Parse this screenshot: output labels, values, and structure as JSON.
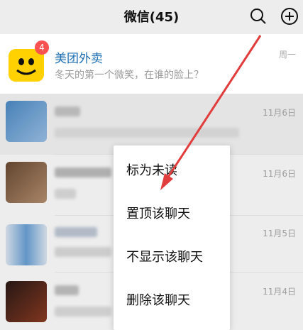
{
  "header": {
    "title": "微信(45)"
  },
  "icons": {
    "search": "search-icon",
    "add": "plus-circle-icon"
  },
  "pinned_chat": {
    "name": "美团外卖",
    "message": "冬天的第一个微笑，在谁的脸上？",
    "time": "周一",
    "badge": "4",
    "name_color": "#1f6fb3"
  },
  "chats": [
    {
      "time": "11月6日"
    },
    {
      "time": "11月6日"
    },
    {
      "time": "11月5日"
    },
    {
      "time": "11月4日"
    }
  ],
  "context_menu": {
    "items": [
      "标为未读",
      "置顶该聊天",
      "不显示该聊天",
      "删除该聊天"
    ]
  },
  "annotation": {
    "arrow_color": "#e23d3d"
  }
}
